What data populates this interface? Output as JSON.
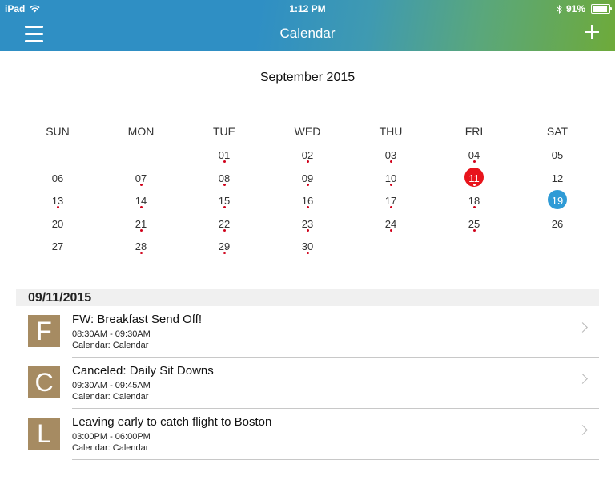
{
  "status": {
    "device": "iPad",
    "time": "1:12 PM",
    "battery": "91%",
    "battery_level": 0.91
  },
  "nav": {
    "title": "Calendar",
    "menu_icon": "hamburger-menu-icon",
    "add_icon": "plus-icon"
  },
  "calendar": {
    "month_title": "September 2015",
    "weekdays": [
      "SUN",
      "MON",
      "TUE",
      "WED",
      "THU",
      "FRI",
      "SAT"
    ],
    "today": "11",
    "selected": "19",
    "today_color": "#e8141c",
    "selected_color": "#2f9bd6",
    "event_dot_color": "#d0021b",
    "weeks": [
      [
        {
          "d": ""
        },
        {
          "d": ""
        },
        {
          "d": "01",
          "dot": true
        },
        {
          "d": "02",
          "dot": true
        },
        {
          "d": "03",
          "dot": true
        },
        {
          "d": "04",
          "dot": true
        },
        {
          "d": "05"
        }
      ],
      [
        {
          "d": "06"
        },
        {
          "d": "07",
          "dot": true
        },
        {
          "d": "08",
          "dot": true
        },
        {
          "d": "09",
          "dot": true
        },
        {
          "d": "10",
          "dot": true
        },
        {
          "d": "11",
          "dot": true
        },
        {
          "d": "12"
        }
      ],
      [
        {
          "d": "13",
          "dot": true
        },
        {
          "d": "14",
          "dot": true
        },
        {
          "d": "15",
          "dot": true
        },
        {
          "d": "16",
          "dot": true
        },
        {
          "d": "17",
          "dot": true
        },
        {
          "d": "18",
          "dot": true
        },
        {
          "d": "19"
        }
      ],
      [
        {
          "d": "20"
        },
        {
          "d": "21",
          "dot": true
        },
        {
          "d": "22",
          "dot": true
        },
        {
          "d": "23",
          "dot": true
        },
        {
          "d": "24",
          "dot": true
        },
        {
          "d": "25",
          "dot": true
        },
        {
          "d": "26"
        }
      ],
      [
        {
          "d": "27"
        },
        {
          "d": "28",
          "dot": true
        },
        {
          "d": "29",
          "dot": true
        },
        {
          "d": "30",
          "dot": true
        },
        {
          "d": ""
        },
        {
          "d": ""
        },
        {
          "d": ""
        }
      ]
    ]
  },
  "agenda": {
    "date": "09/11/2015",
    "events": [
      {
        "initial": "F",
        "title": "FW: Breakfast Send Off!",
        "time": "08:30AM - 09:30AM",
        "calendar": "Calendar: Calendar"
      },
      {
        "initial": "C",
        "title": "Canceled: Daily Sit Downs",
        "time": "09:30AM - 09:45AM",
        "calendar": "Calendar: Calendar"
      },
      {
        "initial": "L",
        "title": "Leaving early to catch flight to Boston",
        "time": "03:00PM - 06:00PM",
        "calendar": "Calendar: Calendar"
      }
    ],
    "avatar_color": "#a68b62"
  }
}
